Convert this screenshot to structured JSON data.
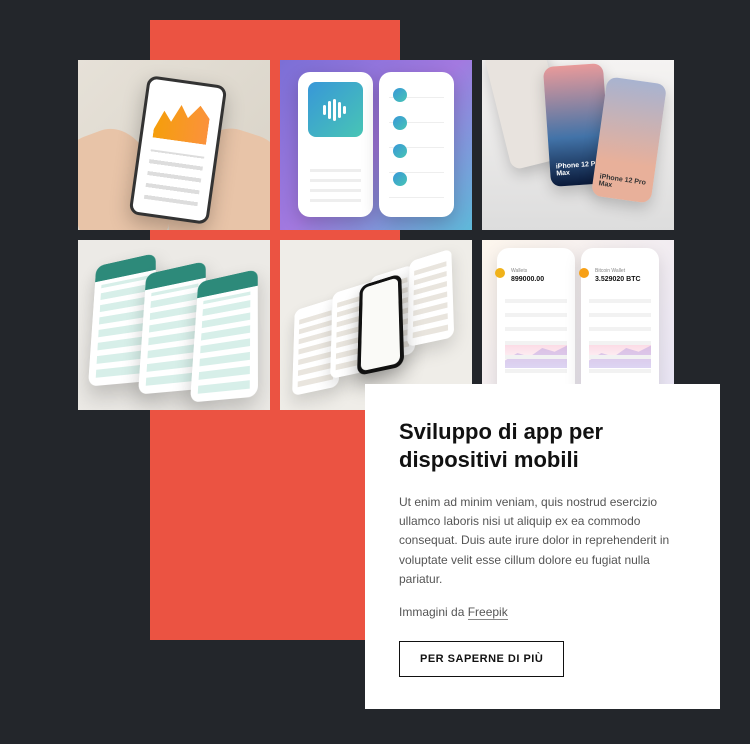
{
  "gallery": {
    "items": [
      {
        "name": "gallery-item-hands-phone"
      },
      {
        "name": "gallery-item-music-player"
      },
      {
        "name": "gallery-item-iphone-fan",
        "label": "iPhone 12 Pro Max"
      },
      {
        "name": "gallery-item-chat-perspective"
      },
      {
        "name": "gallery-item-light-mockups"
      },
      {
        "name": "gallery-item-wallet",
        "wallets": {
          "a_label": "Wallets",
          "a_value": "899000.00",
          "b_label": "Bitcoin Wallet",
          "b_value": "3.529020 BTC"
        }
      }
    ]
  },
  "card": {
    "heading": "Sviluppo di app per dispositivi mobili",
    "body": "Ut enim ad minim veniam, quis nostrud esercizio ullamco laboris nisi ut aliquip ex ea commodo consequat. Duis aute irure dolor in reprehenderit in voluptate velit esse cillum dolore eu fugiat nulla pariatur.",
    "credit_prefix": "Immagini da ",
    "credit_link": "Freepik",
    "cta": "PER SAPERNE DI PIÙ"
  },
  "colors": {
    "bg": "#23262b",
    "accent": "#eb5342"
  }
}
